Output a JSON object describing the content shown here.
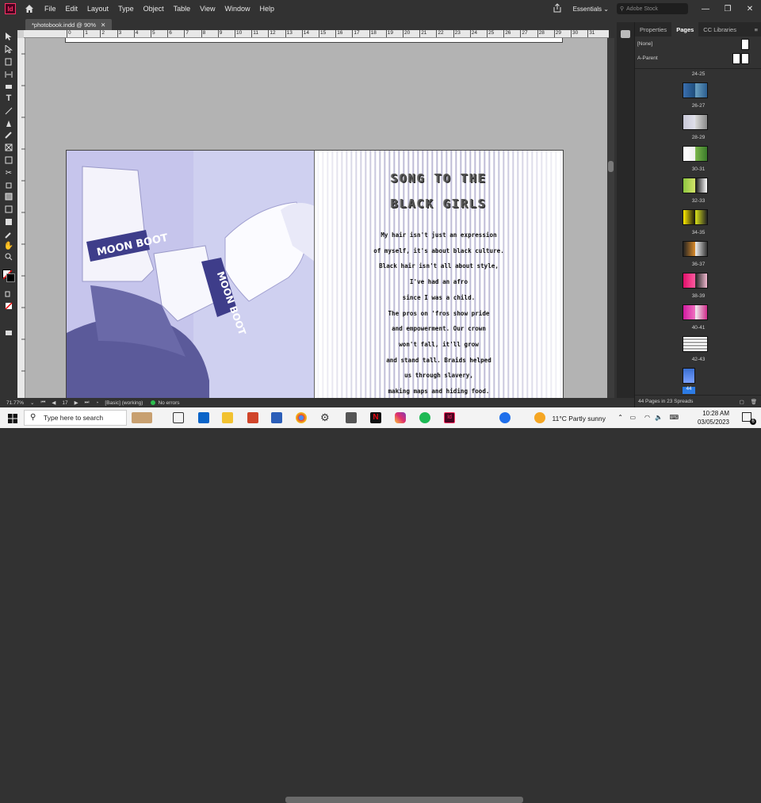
{
  "menubar": {
    "app_logo": "Id",
    "items": [
      "File",
      "Edit",
      "Layout",
      "Type",
      "Object",
      "Table",
      "View",
      "Window",
      "Help"
    ],
    "workspace": "Essentials",
    "stock_search_placeholder": "Adobe Stock"
  },
  "document": {
    "tab_title": "*photobook.indd @ 90%"
  },
  "ruler": {
    "ticks": [
      "0",
      "1",
      "2",
      "3",
      "4",
      "5",
      "6",
      "7",
      "8",
      "9",
      "10",
      "11",
      "12",
      "13",
      "14",
      "15",
      "16",
      "17",
      "18",
      "19",
      "20",
      "21",
      "22",
      "23",
      "24",
      "25",
      "26",
      "27",
      "28",
      "29",
      "30",
      "31"
    ]
  },
  "poem": {
    "title_line1": "SONG TO THE",
    "title_line2": "BLACK GIRLS",
    "lines": [
      "My hair isn't just an expression",
      "of myself, it's about black culture.",
      "Black hair isn't all about style,",
      "I've had an afro",
      "since I was a child.",
      "The pros on 'fros show pride",
      "and empowerment. Our crown",
      "won't fall, it'll grow",
      "and stand tall. Braids helped",
      "us through slavery,",
      "making maps and hiding food."
    ]
  },
  "photo": {
    "boot_text_1": "MOON BOOT",
    "boot_text_2": "MOON BOOT"
  },
  "statusbar": {
    "zoom": "71.77%",
    "page": "17",
    "style": "[Basic] (working)",
    "preflight": "No errors"
  },
  "panel": {
    "tabs": [
      "Properties",
      "Pages",
      "CC Libraries"
    ],
    "active_tab": "Pages",
    "masters": [
      "[None]",
      "A-Parent"
    ],
    "spreads": [
      "24-25",
      "26-27",
      "28-29",
      "30-31",
      "32-33",
      "34-35",
      "36-37",
      "38-39",
      "40-41",
      "42-43",
      "44"
    ],
    "footer": "44 Pages in 23 Spreads"
  },
  "taskbar": {
    "search_placeholder": "Type here to search",
    "weather": "11°C  Partly sunny",
    "time": "10:28 AM",
    "date": "03/05/2023",
    "notification_count": "6"
  },
  "colors": {
    "app_accent": "#ff3366",
    "ui_dark": "#323232",
    "pasteboard": "#b3b3b3",
    "photo_tint": "#c9c9ee"
  }
}
